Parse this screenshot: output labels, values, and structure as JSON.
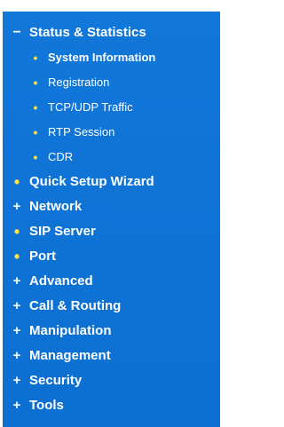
{
  "menu": [
    {
      "label": "Status & Statistics",
      "marker": "−",
      "marker_type": "minus",
      "expanded": true,
      "children": [
        {
          "label": "System Information",
          "marker": "•",
          "active": true
        },
        {
          "label": "Registration",
          "marker": "•"
        },
        {
          "label": "TCP/UDP Traffic",
          "marker": "•"
        },
        {
          "label": "RTP Session",
          "marker": "•"
        },
        {
          "label": "CDR",
          "marker": "•"
        }
      ]
    },
    {
      "label": "Quick Setup Wizard",
      "marker": "•",
      "marker_type": "bullet"
    },
    {
      "label": "Network",
      "marker": "+",
      "marker_type": "plus"
    },
    {
      "label": "SIP Server",
      "marker": "•",
      "marker_type": "bullet"
    },
    {
      "label": "Port",
      "marker": "•",
      "marker_type": "bullet"
    },
    {
      "label": "Advanced",
      "marker": "+",
      "marker_type": "plus"
    },
    {
      "label": "Call & Routing",
      "marker": "+",
      "marker_type": "plus"
    },
    {
      "label": "Manipulation",
      "marker": "+",
      "marker_type": "plus"
    },
    {
      "label": "Management",
      "marker": "+",
      "marker_type": "plus"
    },
    {
      "label": "Security",
      "marker": "+",
      "marker_type": "plus"
    },
    {
      "label": "Tools",
      "marker": "+",
      "marker_type": "plus"
    }
  ],
  "colors": {
    "panel_background": "#0f73d6",
    "text": "#ffffff",
    "bullet": "#ffe24a"
  }
}
